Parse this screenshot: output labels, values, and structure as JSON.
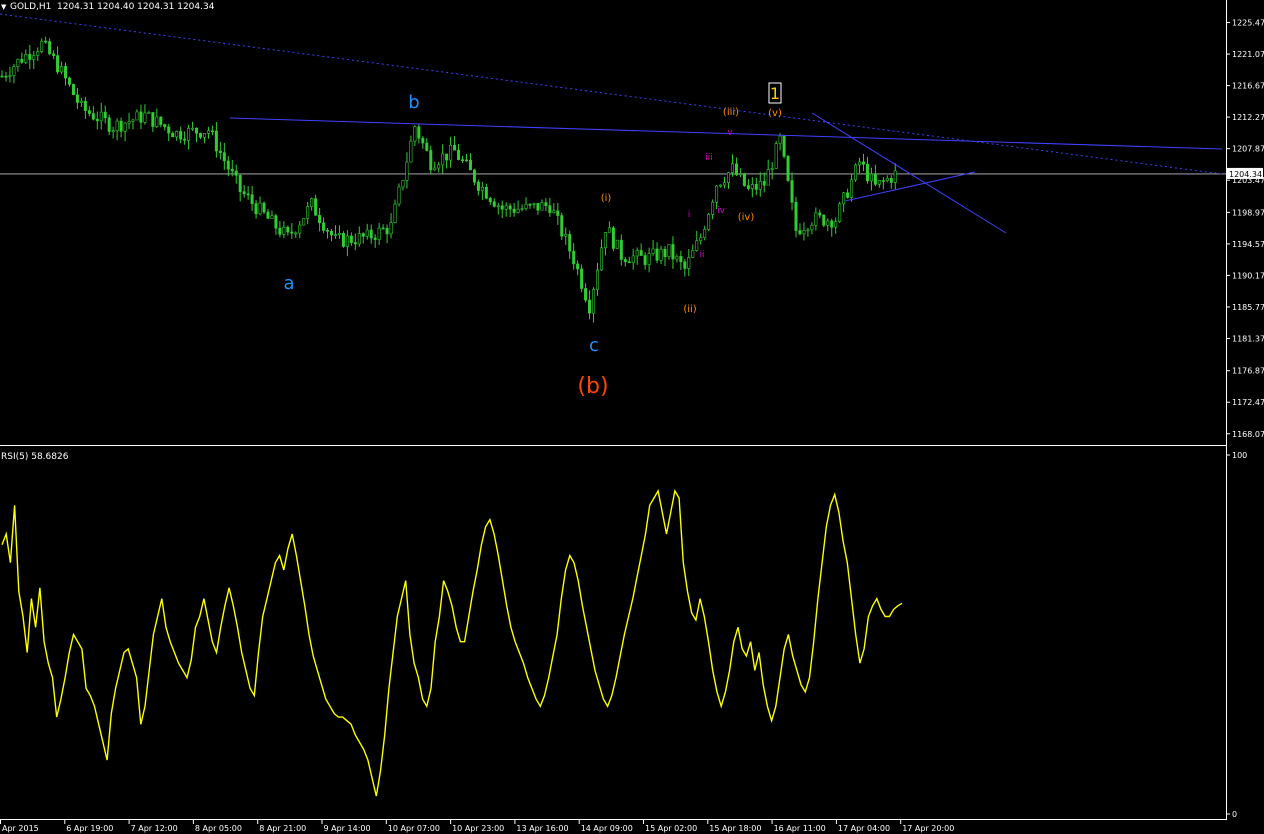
{
  "header": {
    "symbol": "GOLD,H1",
    "ohlc": "1204.31 1204.40 1204.31 1204.34",
    "arrow": "▼"
  },
  "colors": {
    "background": "#000000",
    "candles": "#32cd32",
    "price_line": "#c0c0c0",
    "trend_lines": "#4040ff",
    "rsi_line": "#ffff00",
    "wave_major": "#1e90ff",
    "wave_b": "#ff4500",
    "wave_minor": "#ff8c00",
    "wave_sub": "#cc00cc",
    "wave_1_box": "#ffcc00",
    "axis_text": "#ffffff"
  },
  "chart_data": [
    {
      "type": "candlestick",
      "title": "GOLD,H1",
      "ylim": [
        1166.5,
        1227.5
      ],
      "price_axis_ticks": [
        "1225.47",
        "1221.07",
        "1216.67",
        "1212.27",
        "1207.87",
        "1203.47",
        "1198.97",
        "1194.57",
        "1190.17",
        "1185.77",
        "1181.37",
        "1176.87",
        "1172.47",
        "1168.07"
      ],
      "current_price": "1204.34",
      "x_tick_labels": [
        "Apr 2015",
        "6 Apr 19:00",
        "7 Apr 12:00",
        "8 Apr 05:00",
        "8 Apr 21:00",
        "9 Apr 14:00",
        "10 Apr 07:00",
        "10 Apr 23:00",
        "13 Apr 16:00",
        "14 Apr 09:00",
        "15 Apr 02:00",
        "15 Apr 18:00",
        "16 Apr 11:00",
        "17 Apr 04:00",
        "17 Apr 20:00"
      ],
      "approx_close_path": [
        {
          "bar": 0,
          "close": 1218.0
        },
        {
          "bar": 5,
          "close": 1220.5
        },
        {
          "bar": 10,
          "close": 1222.5
        },
        {
          "bar": 14,
          "close": 1219.5
        },
        {
          "bar": 20,
          "close": 1213.5
        },
        {
          "bar": 28,
          "close": 1211.0
        },
        {
          "bar": 36,
          "close": 1212.5
        },
        {
          "bar": 44,
          "close": 1210.0
        },
        {
          "bar": 52,
          "close": 1210.5
        },
        {
          "bar": 60,
          "close": 1202.0
        },
        {
          "bar": 68,
          "close": 1197.5
        },
        {
          "bar": 72,
          "close": 1195.5
        },
        {
          "bar": 78,
          "close": 1200.0
        },
        {
          "bar": 84,
          "close": 1195.0
        },
        {
          "bar": 92,
          "close": 1195.5
        },
        {
          "bar": 98,
          "close": 1197.0
        },
        {
          "bar": 104,
          "close": 1211.0
        },
        {
          "bar": 108,
          "close": 1206.0
        },
        {
          "bar": 114,
          "close": 1207.5
        },
        {
          "bar": 120,
          "close": 1203.0
        },
        {
          "bar": 126,
          "close": 1199.5
        },
        {
          "bar": 132,
          "close": 1199.5
        },
        {
          "bar": 138,
          "close": 1200.0
        },
        {
          "bar": 144,
          "close": 1192.5
        },
        {
          "bar": 148,
          "close": 1186.0
        },
        {
          "bar": 152,
          "close": 1197.0
        },
        {
          "bar": 156,
          "close": 1193.0
        },
        {
          "bar": 162,
          "close": 1192.5
        },
        {
          "bar": 168,
          "close": 1193.5
        },
        {
          "bar": 172,
          "close": 1191.0
        },
        {
          "bar": 176,
          "close": 1195.5
        },
        {
          "bar": 180,
          "close": 1203.0
        },
        {
          "bar": 184,
          "close": 1205.0
        },
        {
          "bar": 188,
          "close": 1202.0
        },
        {
          "bar": 192,
          "close": 1203.0
        },
        {
          "bar": 196,
          "close": 1209.0
        },
        {
          "bar": 200,
          "close": 1196.5
        },
        {
          "bar": 204,
          "close": 1198.0
        },
        {
          "bar": 210,
          "close": 1198.0
        },
        {
          "bar": 216,
          "close": 1206.0
        },
        {
          "bar": 220,
          "close": 1202.5
        },
        {
          "bar": 225,
          "close": 1204.3
        }
      ],
      "trend_lines": [
        {
          "name": "upper-dotted",
          "style": "dotted"
        },
        {
          "name": "resistance",
          "style": "solid"
        },
        {
          "name": "triangle-upper",
          "style": "solid"
        },
        {
          "name": "triangle-lower",
          "style": "solid"
        }
      ],
      "wave_labels": [
        {
          "text": "a",
          "group": "major"
        },
        {
          "text": "b",
          "group": "major"
        },
        {
          "text": "c",
          "group": "major"
        },
        {
          "text": "(b)",
          "group": "b"
        },
        {
          "text": "(i)",
          "group": "minor"
        },
        {
          "text": "(ii)",
          "group": "minor"
        },
        {
          "text": "(iii)",
          "group": "minor"
        },
        {
          "text": "(iv)",
          "group": "minor"
        },
        {
          "text": "(v)",
          "group": "minor"
        },
        {
          "text": "i",
          "group": "sub"
        },
        {
          "text": "ii",
          "group": "sub"
        },
        {
          "text": "iii",
          "group": "sub"
        },
        {
          "text": "iv",
          "group": "sub"
        },
        {
          "text": "v",
          "group": "sub"
        },
        {
          "text": "1",
          "group": "box"
        }
      ]
    },
    {
      "type": "line",
      "title": "RSI(5) 58.6826",
      "ylim": [
        0,
        100
      ],
      "axis_ticks": [
        "100",
        "0"
      ],
      "series": [
        {
          "name": "RSI(5)",
          "values": [
            75,
            78,
            70,
            86,
            62,
            55,
            45,
            60,
            52,
            63,
            48,
            42,
            38,
            27,
            32,
            38,
            45,
            50,
            48,
            46,
            35,
            33,
            30,
            25,
            20,
            15,
            28,
            35,
            40,
            45,
            46,
            42,
            38,
            25,
            30,
            40,
            50,
            55,
            60,
            52,
            48,
            45,
            42,
            40,
            38,
            43,
            52,
            55,
            60,
            54,
            48,
            45,
            52,
            58,
            63,
            58,
            52,
            45,
            40,
            35,
            33,
            45,
            55,
            60,
            65,
            70,
            72,
            68,
            74,
            78,
            72,
            65,
            58,
            50,
            44,
            40,
            36,
            32,
            30,
            28,
            27,
            27,
            26,
            25,
            22,
            20,
            18,
            15,
            10,
            5,
            12,
            22,
            35,
            45,
            55,
            60,
            65,
            50,
            42,
            38,
            32,
            30,
            35,
            48,
            55,
            65,
            62,
            58,
            52,
            48,
            48,
            55,
            62,
            68,
            75,
            80,
            82,
            78,
            72,
            65,
            58,
            52,
            48,
            45,
            42,
            38,
            35,
            32,
            30,
            33,
            38,
            44,
            50,
            60,
            68,
            72,
            70,
            65,
            58,
            52,
            46,
            40,
            36,
            32,
            30,
            33,
            38,
            44,
            50,
            55,
            60,
            66,
            72,
            78,
            86,
            88,
            90,
            84,
            78,
            84,
            90,
            88,
            70,
            62,
            56,
            54,
            60,
            55,
            48,
            40,
            34,
            30,
            34,
            40,
            48,
            52,
            46,
            44,
            48,
            40,
            45,
            36,
            30,
            26,
            30,
            38,
            46,
            50,
            44,
            40,
            36,
            34,
            38,
            48,
            60,
            70,
            80,
            86,
            89,
            84,
            76,
            70,
            60,
            50,
            42,
            46,
            55,
            58,
            60,
            57,
            55,
            55,
            57,
            58,
            58.7
          ]
        }
      ]
    }
  ]
}
